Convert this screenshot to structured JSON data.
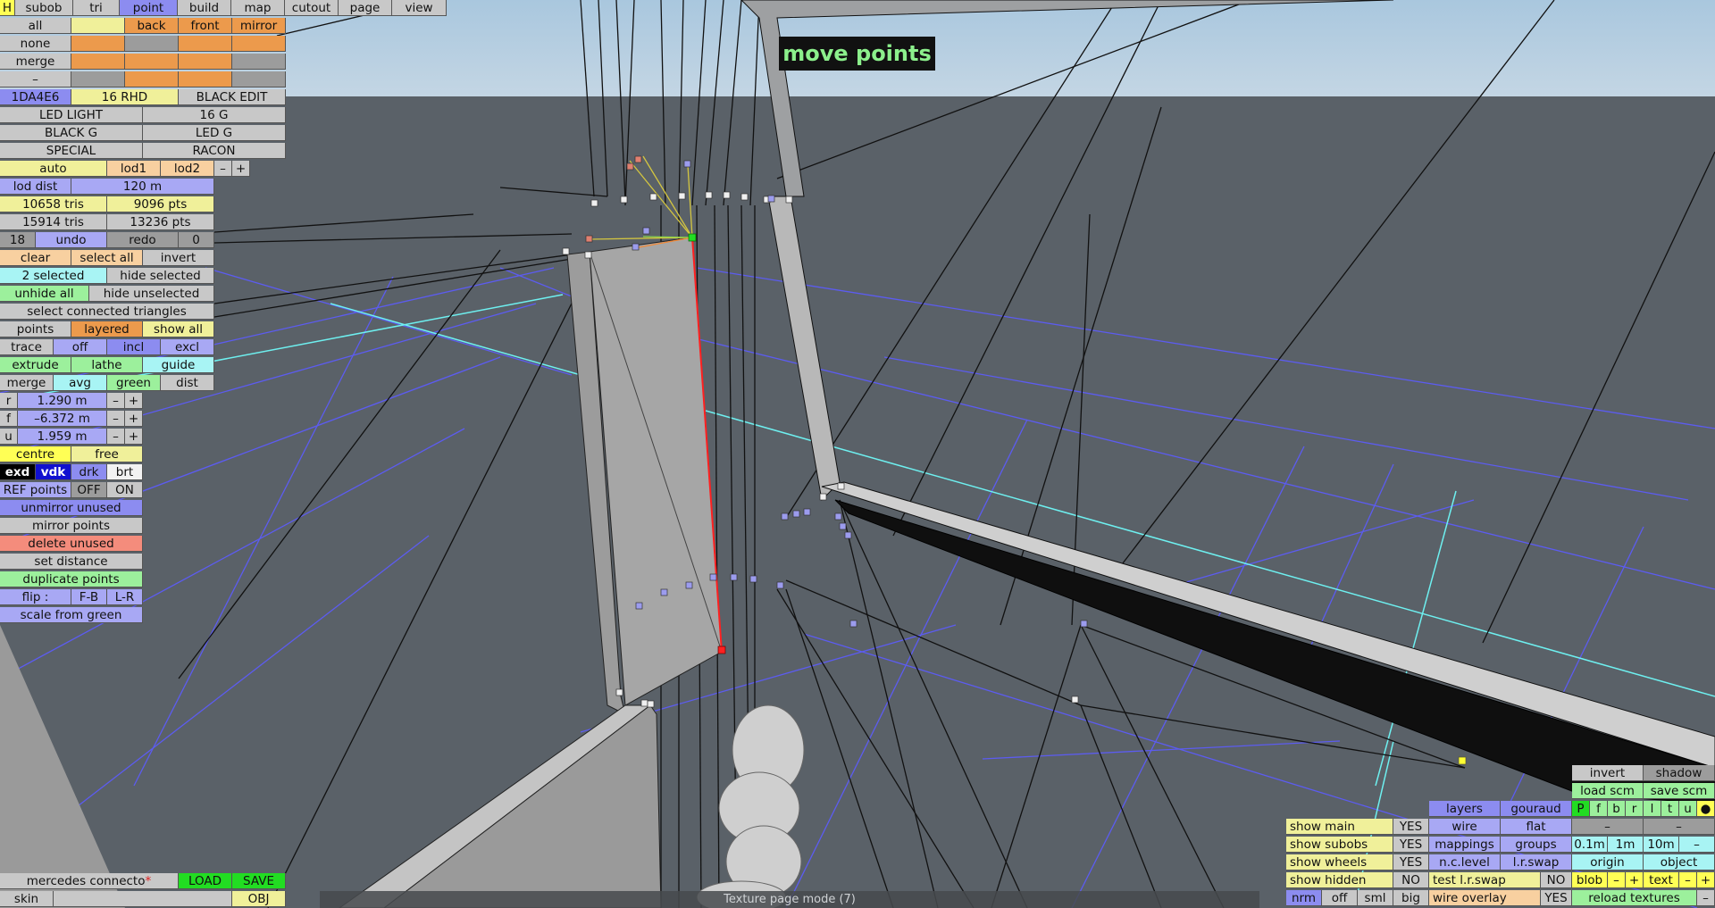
{
  "top_menu": {
    "h": "H",
    "subob": "subob",
    "tri": "tri",
    "point": "point",
    "build": "build",
    "map": "map",
    "cutout": "cutout",
    "page": "page",
    "view": "view"
  },
  "selection": {
    "all": "all",
    "back": "back",
    "front": "front",
    "mirror": "mirror",
    "none": "none",
    "merge": "merge",
    "dash": "–"
  },
  "materials": {
    "code": "1DA4E6",
    "rhd": "16 RHD",
    "black_edit": "BLACK EDIT",
    "led_light": "LED LIGHT",
    "g16": "16 G",
    "black_g": "BLACK G",
    "led_g": "LED G",
    "special": "SPECIAL",
    "racon": "RACON"
  },
  "lod": {
    "auto": "auto",
    "lod1": "lod1",
    "lod2": "lod2",
    "minus": "–",
    "plus": "+",
    "dist_label": "lod dist",
    "dist_value": "120 m"
  },
  "stats": {
    "tris1": "10658 tris",
    "pts1": "9096 pts",
    "tris2": "15914 tris",
    "pts2": "13236 pts"
  },
  "undo": {
    "count": "18",
    "undo": "undo",
    "redo": "redo",
    "redo_count": "0"
  },
  "select_ops": {
    "clear": "clear",
    "select_all": "select all",
    "invert": "invert",
    "selected_count": "2 selected",
    "hide_selected": "hide selected",
    "unhide_all": "unhide all",
    "hide_unselected": "hide unselected",
    "select_connected": "select connected triangles",
    "points": "points",
    "layered": "layered",
    "show_all": "show all",
    "trace": "trace",
    "off": "off",
    "incl": "incl",
    "excl": "excl",
    "extrude": "extrude",
    "lathe": "lathe",
    "guide": "guide",
    "merge": "merge",
    "avg": "avg",
    "green": "green",
    "dist": "dist"
  },
  "coords": {
    "r_label": "r",
    "r_value": "1.290 m",
    "f_label": "f",
    "f_value": "–6.372 m",
    "u_label": "u",
    "u_value": "1.959 m",
    "minus": "–",
    "plus": "+"
  },
  "point_ops": {
    "centre": "centre",
    "free": "free",
    "exd": "exd",
    "vdk": "vdk",
    "drk": "drk",
    "brt": "brt",
    "ref_points": "REF points",
    "ref_off": "OFF",
    "ref_on": "ON",
    "unmirror_unused": "unmirror unused",
    "mirror_points": "mirror points",
    "delete_unused": "delete unused",
    "set_distance": "set distance",
    "duplicate_points": "duplicate points",
    "flip": "flip :",
    "fb": "F-B",
    "lr": "L-R",
    "scale_from_green": "scale from green"
  },
  "mode_banner": "move points",
  "status_bar": "Texture page mode (7)",
  "file": {
    "name": "mercedes connecto",
    "modified_mark": "*",
    "load": "LOAD",
    "save": "SAVE",
    "skin": "skin",
    "obj": "OBJ"
  },
  "view_options": {
    "show_main": "show main",
    "show_main_v": "YES",
    "show_subobs": "show subobs",
    "show_subobs_v": "YES",
    "show_wheels": "show wheels",
    "show_wheels_v": "YES",
    "show_hidden": "show hidden",
    "show_hidden_v": "NO",
    "nrm": "nrm",
    "off": "off",
    "sml": "sml",
    "big": "big",
    "layers": "layers",
    "gouraud": "gouraud",
    "wire": "wire",
    "flat": "flat",
    "mappings": "mappings",
    "groups": "groups",
    "nc_level": "n.c.level",
    "lr_swap": "l.r.swap",
    "test_lr_swap": "test l.r.swap",
    "test_lr_swap_v": "NO",
    "wire_overlay": "wire overlay",
    "wire_overlay_v": "YES",
    "invert": "invert",
    "shadow": "shadow",
    "load_scm": "load scm",
    "save_scm": "save scm",
    "view_letters": [
      "P",
      "f",
      "b",
      "r",
      "l",
      "t",
      "u"
    ],
    "dot": "●",
    "dash": "–",
    "g01": "0.1m",
    "g1": "1m",
    "g10": "10m",
    "origin": "origin",
    "object": "object",
    "blob": "blob",
    "text": "text",
    "minus": "–",
    "plus": "+",
    "reload_textures": "reload textures"
  },
  "colors": {
    "sky_top": "#a9c7de",
    "floor": "#5a6168",
    "grid_blue": "#5c5cf0",
    "grid_cyan": "#6ef0f0",
    "selection_green": "#22dd22",
    "edge_red": "#ff2020"
  }
}
